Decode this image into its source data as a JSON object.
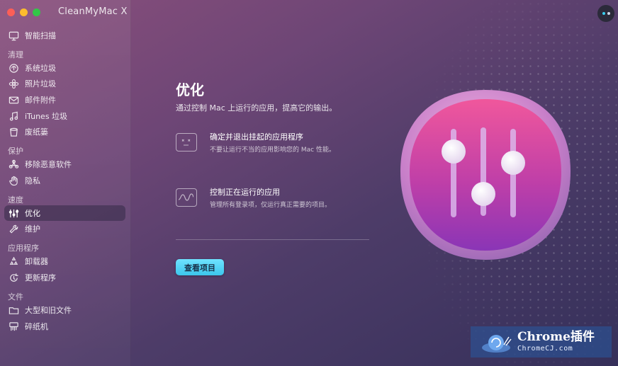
{
  "app": {
    "title": "CleanMyMac X"
  },
  "sidebar": {
    "top_item": {
      "label": "智能扫描",
      "icon": "monitor-icon"
    },
    "sections": [
      {
        "label": "清理",
        "items": [
          {
            "label": "系统垃圾",
            "icon": "system-junk-icon"
          },
          {
            "label": "照片垃圾",
            "icon": "photo-junk-icon"
          },
          {
            "label": "邮件附件",
            "icon": "mail-icon"
          },
          {
            "label": "iTunes 垃圾",
            "icon": "music-note-icon"
          },
          {
            "label": "废纸篓",
            "icon": "trash-icon"
          }
        ]
      },
      {
        "label": "保护",
        "items": [
          {
            "label": "移除恶意软件",
            "icon": "biohazard-icon"
          },
          {
            "label": "隐私",
            "icon": "hand-icon"
          }
        ]
      },
      {
        "label": "速度",
        "items": [
          {
            "label": "优化",
            "icon": "sliders-icon",
            "active": true
          },
          {
            "label": "维护",
            "icon": "wrench-icon"
          }
        ]
      },
      {
        "label": "应用程序",
        "items": [
          {
            "label": "卸载器",
            "icon": "uninstaller-icon"
          },
          {
            "label": "更新程序",
            "icon": "updater-icon"
          }
        ]
      },
      {
        "label": "文件",
        "items": [
          {
            "label": "大型和旧文件",
            "icon": "folder-icon"
          },
          {
            "label": "碎纸机",
            "icon": "shredder-icon"
          }
        ]
      }
    ]
  },
  "main": {
    "title": "优化",
    "subtitle": "通过控制 Mac 上运行的应用，提高它的输出。",
    "features": [
      {
        "title": "确定并退出挂起的应用程序",
        "desc": "不要让运行不当的应用影响您的 Mac 性能。",
        "icon": "hung-app-face-icon"
      },
      {
        "title": "控制正在运行的应用",
        "desc": "管理所有登录项，仅运行真正需要的项目。",
        "icon": "activity-wave-icon"
      }
    ],
    "view_button": "查看项目"
  },
  "watermark": {
    "line1": "Chrome插件",
    "line2": "ChromeCJ.com"
  },
  "colors": {
    "accent": "#3cc6ec",
    "hero_pink": "#e84b9a",
    "hero_purple": "#8a3fb8"
  }
}
